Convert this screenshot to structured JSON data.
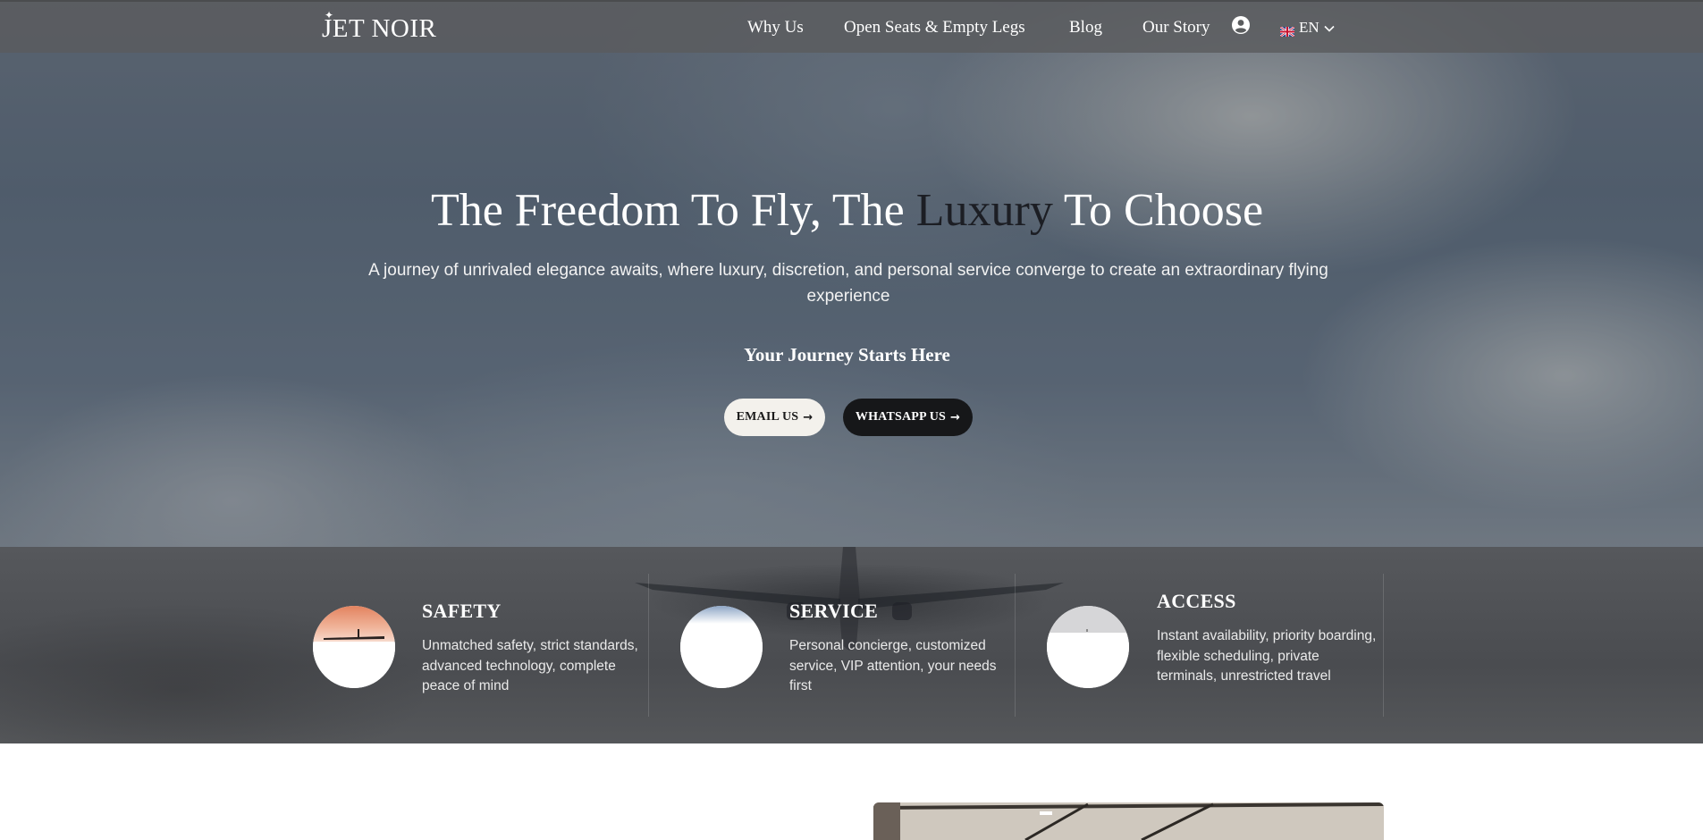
{
  "brand": {
    "name": "JET NOIR",
    "star": "✦"
  },
  "nav": {
    "items": [
      {
        "label": "Why Us"
      },
      {
        "label": "Open Seats & Empty Legs"
      },
      {
        "label": "Blog"
      },
      {
        "label": "Our Story"
      }
    ],
    "user_icon": "user-circle-icon",
    "language": {
      "flag": "uk-flag-icon",
      "code": "EN",
      "chevron": "chevron-down-icon"
    }
  },
  "hero": {
    "title_before": "The Freedom To Fly, The ",
    "title_accent": "Luxury",
    "title_after": " To Choose",
    "subtitle": "A journey of unrivaled elegance awaits, where luxury, discretion, and personal service converge to create an extraordinary flying experience",
    "tagline": "Your Journey Starts Here",
    "buttons": {
      "email": {
        "label": "EMAIL US",
        "icon": "arrow-right-icon"
      },
      "whatsapp": {
        "label": "WHATSAPP US",
        "icon": "arrow-right-icon"
      }
    }
  },
  "features": [
    {
      "title": "SAFETY",
      "description": "Unmatched safety, strict standards, advanced technology, complete peace of mind"
    },
    {
      "title": "SERVICE",
      "description": "Personal concierge, customized service, VIP attention, your needs first"
    },
    {
      "title": "ACCESS",
      "description": "Instant availability, priority boarding, flexible scheduling, private terminals, unrestricted travel"
    }
  ],
  "colors": {
    "accent_text": "#1c1e24",
    "email_button_bg": "#f3f1ec",
    "whatsapp_button_bg": "#161719",
    "navbar_bg": "#5a5c5e",
    "features_bg": "#4a4c50"
  }
}
